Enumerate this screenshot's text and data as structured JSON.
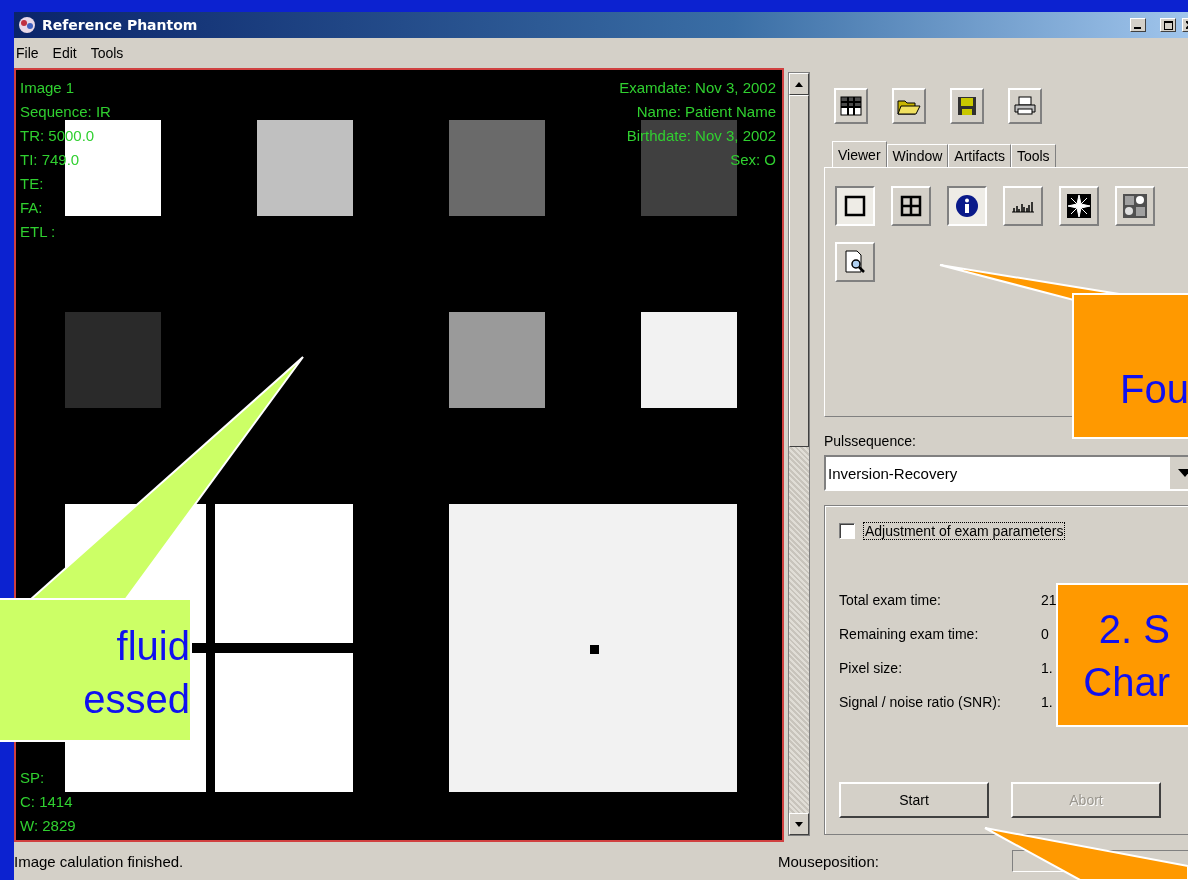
{
  "window": {
    "title": "Reference Phantom"
  },
  "menu": [
    "File",
    "Edit",
    "Tools"
  ],
  "image_view": {
    "overlay_top_left": [
      "Image 1",
      "Sequence: IR",
      "TR: 5000.0",
      "TI: 749.0",
      "TE:",
      "FA:",
      "ETL :"
    ],
    "overlay_top_right": [
      "Examdate: Nov 3, 2002",
      "Name: Patient Name",
      "Birthdate: Nov 3, 2002",
      "Sex: O"
    ],
    "overlay_bottom_left": [
      "SP:",
      "C: 1414",
      "W: 2829"
    ]
  },
  "toolbar": [
    {
      "kind": "grid"
    },
    {
      "kind": "open"
    },
    {
      "kind": "save"
    },
    {
      "kind": "print"
    }
  ],
  "tabs": [
    {
      "label": "Viewer",
      "selected": true
    },
    {
      "label": "Window",
      "selected": false
    },
    {
      "label": "Artifacts",
      "selected": false
    },
    {
      "label": "Tools",
      "selected": false
    }
  ],
  "viewer_tools": [
    {
      "kind": "single",
      "selected": true
    },
    {
      "kind": "quad",
      "selected": false
    },
    {
      "kind": "info",
      "selected": true
    },
    {
      "kind": "histogram",
      "selected": false
    },
    {
      "kind": "starburst",
      "selected": false
    },
    {
      "kind": "noise",
      "selected": false
    },
    {
      "kind": "zoom",
      "selected": false
    }
  ],
  "pulssequence": {
    "label": "Pulssequence:",
    "value": "Inversion-Recovery"
  },
  "adjustment": {
    "label": "Adjustment of exam parameters",
    "checked": false
  },
  "exam_info": [
    {
      "label": "Total exam time:",
      "value": "21"
    },
    {
      "label": "Remaining exam time:",
      "value": "0"
    },
    {
      "label": "Pixel size:",
      "value": "1."
    },
    {
      "label": "Signal / noise ratio (SNR):",
      "value": "1."
    }
  ],
  "buttons": [
    {
      "label": "Start",
      "disabled": false
    },
    {
      "label": "Abort",
      "disabled": true
    }
  ],
  "status_bar": {
    "message": "Image calulation finished.",
    "mouse_label": "Mouseposition:"
  },
  "callouts": [
    {
      "lines": [
        "fluid",
        "essed"
      ],
      "color": "#ccff66"
    },
    {
      "lines": [
        "Fou"
      ],
      "color": "#ff9900"
    },
    {
      "lines": [
        "2. S",
        "Char"
      ],
      "color": "#ff9900"
    }
  ]
}
